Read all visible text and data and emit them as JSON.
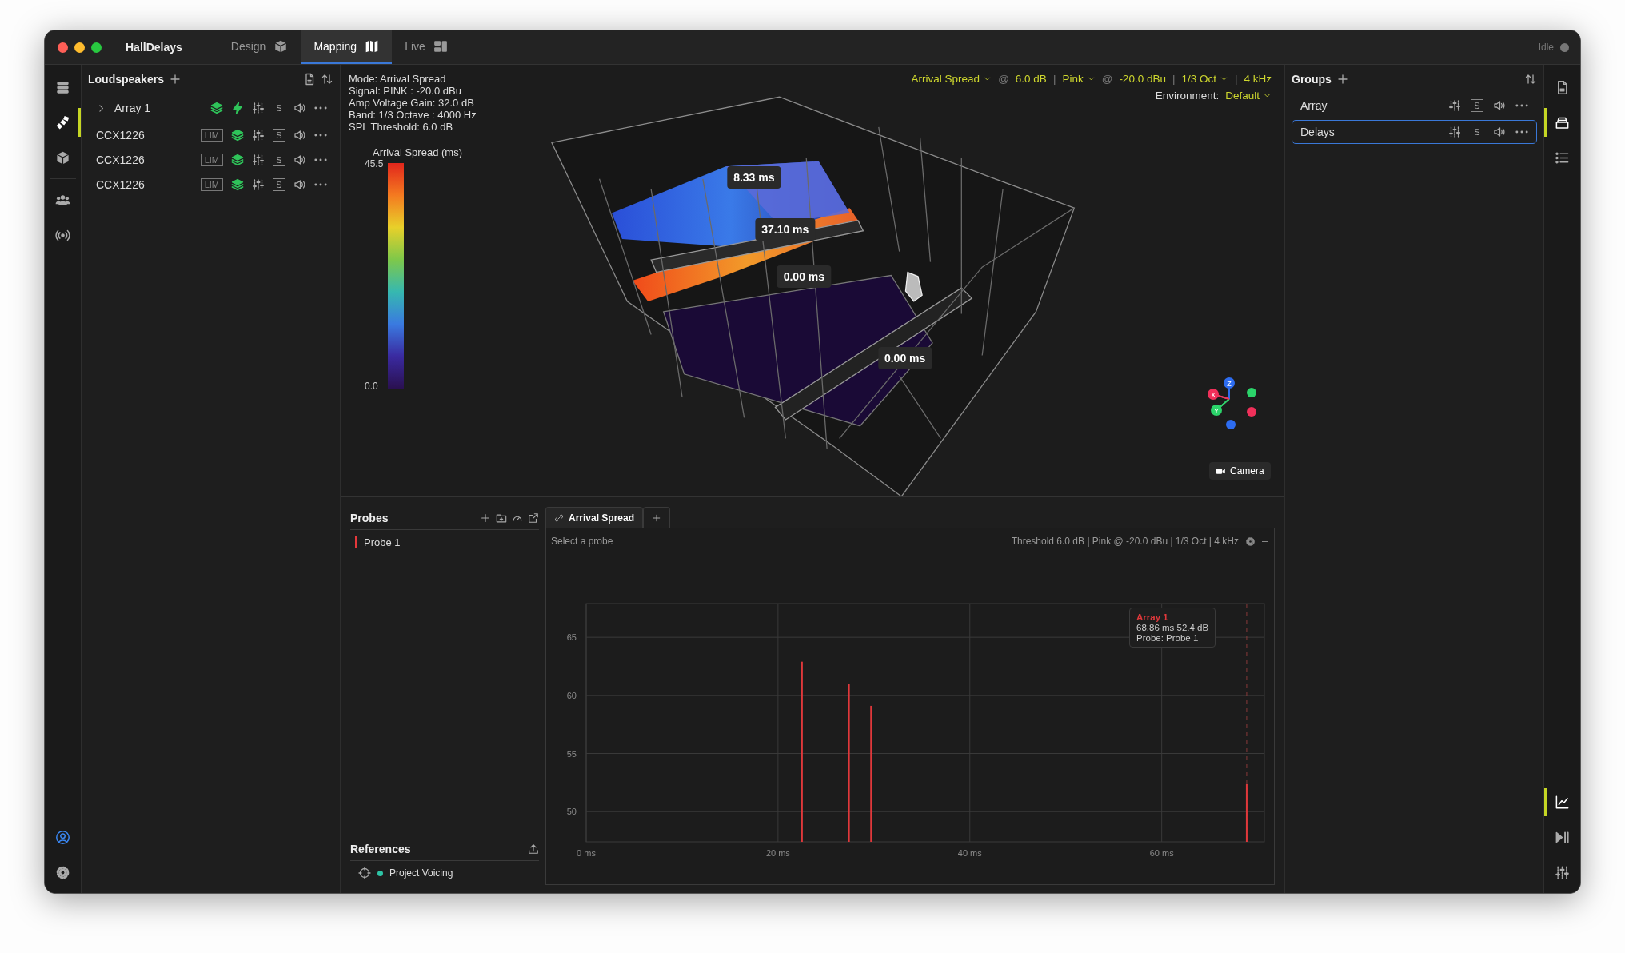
{
  "window": {
    "title": "HallDelays",
    "status": "Idle"
  },
  "tabs": [
    {
      "label": "Design",
      "selected": false
    },
    {
      "label": "Mapping",
      "selected": true
    },
    {
      "label": "Live",
      "selected": false
    }
  ],
  "left_rail": [
    {
      "selected": false
    },
    {
      "selected": true
    },
    {
      "selected": false
    },
    {
      "selected": false
    },
    {
      "selected": false
    }
  ],
  "loudspeakers": {
    "title": "Loudspeakers",
    "items": [
      {
        "kind": "array",
        "name": "Array 1",
        "expanded": false,
        "solo": "S"
      },
      {
        "kind": "speaker",
        "name": "CCX1226",
        "limiter": "LIM",
        "solo": "S"
      },
      {
        "kind": "speaker",
        "name": "CCX1226",
        "limiter": "LIM",
        "solo": "S"
      },
      {
        "kind": "speaker",
        "name": "CCX1226",
        "limiter": "LIM",
        "solo": "S"
      }
    ]
  },
  "viewport": {
    "info_lines": [
      "Mode: Arrival Spread",
      "Signal: PINK : -20.0 dBu",
      "Amp Voltage Gain: 32.0 dB",
      "Band: 1/3 Octave : 4000 Hz",
      "SPL Threshold: 6.0 dB"
    ],
    "controls": [
      {
        "kind": "dropdown",
        "text": "Arrival Spread"
      },
      {
        "kind": "symbol",
        "text": "@"
      },
      {
        "kind": "value",
        "text": "6.0 dB"
      },
      {
        "kind": "symbol",
        "text": "|"
      },
      {
        "kind": "dropdown",
        "text": "Pink"
      },
      {
        "kind": "symbol",
        "text": "@"
      },
      {
        "kind": "value",
        "text": "-20.0 dBu"
      },
      {
        "kind": "symbol",
        "text": "|"
      },
      {
        "kind": "dropdown",
        "text": "1/3 Oct"
      },
      {
        "kind": "symbol",
        "text": "|"
      },
      {
        "kind": "value",
        "text": "4 kHz"
      }
    ],
    "environment": {
      "label": "Environment:",
      "value": "Default"
    },
    "colorbar": {
      "title": "Arrival Spread (ms)",
      "max": "45.5",
      "min": "0.0"
    },
    "labels": [
      "8.33 ms",
      "37.10 ms",
      "0.00 ms",
      "0.00 ms"
    ],
    "axes": [
      "X",
      "Y",
      "Z"
    ],
    "camera_button": "Camera"
  },
  "groups": {
    "title": "Groups",
    "items": [
      {
        "name": "Array",
        "selected": false,
        "solo": "S"
      },
      {
        "name": "Delays",
        "selected": true,
        "solo": "S"
      }
    ]
  },
  "right_rail": {
    "top": [
      {
        "selected": false
      },
      {
        "selected": true
      },
      {
        "selected": false
      }
    ],
    "bottom": [
      {
        "selected": true
      },
      {
        "selected": false
      },
      {
        "selected": false
      }
    ]
  },
  "probes": {
    "title": "Probes",
    "items": [
      {
        "name": "Probe 1",
        "color": "#e5383b"
      }
    ]
  },
  "references": {
    "title": "References",
    "items": [
      {
        "name": "Project Voicing",
        "color": "#2ec4a6"
      }
    ]
  },
  "analysis": {
    "tabs": [
      {
        "label": "Arrival Spread",
        "selected": true
      }
    ],
    "hint": "Select a probe",
    "summary": "Threshold 6.0 dB | Pink @ -20.0 dBu | 1/3 Oct | 4 kHz",
    "tooltip": {
      "values": "68.86 ms 52.4 dB",
      "probe": "Probe: Probe 1"
    },
    "chart_data": {
      "type": "bar",
      "x": [
        22.5,
        27.4,
        29.7,
        68.86
      ],
      "series": [
        {
          "name": "Array 1",
          "color": "#e0383b",
          "values": [
            62.9,
            61.0,
            59.1,
            52.4
          ]
        }
      ],
      "xlim": [
        0,
        70.7
      ],
      "ylim": [
        47.4,
        67.9
      ],
      "xticks": [
        {
          "value": 0,
          "label": "0 ms"
        },
        {
          "value": 20,
          "label": "20 ms"
        },
        {
          "value": 40,
          "label": "40 ms"
        },
        {
          "value": 60,
          "label": "60 ms"
        }
      ],
      "yticks": [
        50,
        55,
        60,
        65
      ],
      "grid": true,
      "ref_lines": [
        {
          "axis": "x",
          "value": 68.86
        }
      ]
    }
  }
}
